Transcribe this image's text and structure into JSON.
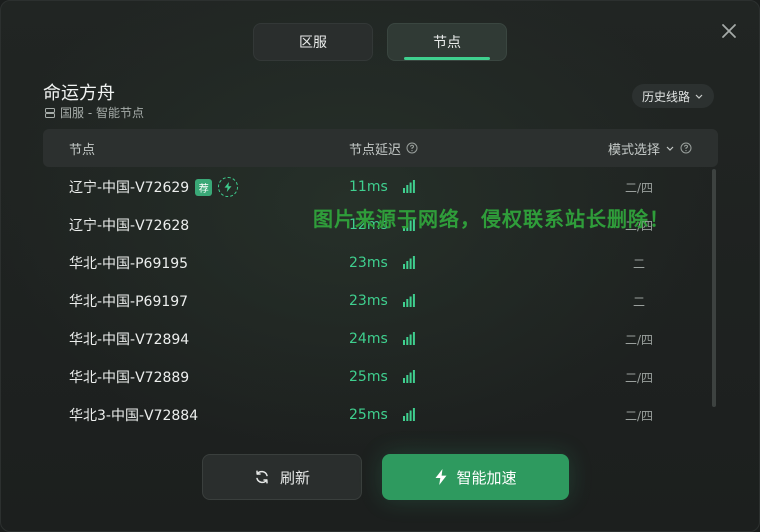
{
  "tabs": [
    {
      "label": "区服",
      "active": false
    },
    {
      "label": "节点",
      "active": true
    }
  ],
  "game": {
    "title": "命运方舟",
    "subtitle": "国服 - 智能节点"
  },
  "history_button": "历史线路",
  "table": {
    "headers": {
      "node": "节点",
      "latency": "节点延迟",
      "mode": "模式选择"
    },
    "recommend_badge": "荐",
    "rows": [
      {
        "name": "辽宁-中国-V72629",
        "latency": "11ms",
        "mode": "二/四",
        "recommended": true
      },
      {
        "name": "辽宁-中国-V72628",
        "latency": "12ms",
        "mode": "二/四"
      },
      {
        "name": "华北-中国-P69195",
        "latency": "23ms",
        "mode": "二"
      },
      {
        "name": "华北-中国-P69197",
        "latency": "23ms",
        "mode": "二"
      },
      {
        "name": "华北-中国-V72894",
        "latency": "24ms",
        "mode": "二/四"
      },
      {
        "name": "华北-中国-V72889",
        "latency": "25ms",
        "mode": "二/四"
      },
      {
        "name": "华北3-中国-V72884",
        "latency": "25ms",
        "mode": "二/四"
      }
    ]
  },
  "watermark": "图片来源于网络，侵权联系站长删除！",
  "buttons": {
    "refresh": "刷新",
    "accelerate": "智能加速"
  },
  "colors": {
    "accent": "#3fd08f",
    "primary_button": "#2e9a5f",
    "watermark": "#2f9d3a"
  },
  "icons": [
    "close-icon",
    "server-icon",
    "chevron-down-icon",
    "help-icon",
    "lightning-icon",
    "signal-icon",
    "refresh-icon"
  ]
}
